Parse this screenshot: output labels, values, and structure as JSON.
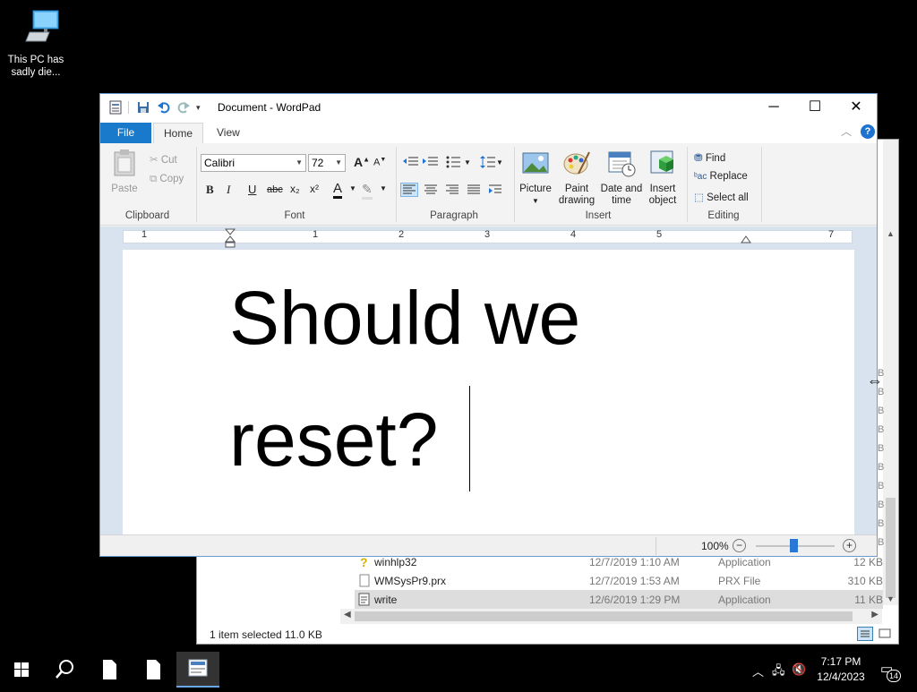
{
  "desktop": {
    "icon_label": "This PC has sadly die..."
  },
  "explorer": {
    "rows": [
      {
        "name": "winhlp32",
        "date": "12/7/2019 1:10 AM",
        "type": "Application",
        "size": "12 KB",
        "selected": false
      },
      {
        "name": "WMSysPr9.prx",
        "date": "12/7/2019 1:53 AM",
        "type": "PRX File",
        "size": "310 KB",
        "selected": false
      },
      {
        "name": "write",
        "date": "12/6/2019 1:29 PM",
        "type": "Application",
        "size": "11 KB",
        "selected": true
      }
    ],
    "status": "1 item selected  11.0 KB",
    "side_letter": "B"
  },
  "wordpad": {
    "title": "Document - WordPad",
    "tabs": {
      "file": "File",
      "home": "Home",
      "view": "View"
    },
    "help": "?",
    "clipboard": {
      "paste": "Paste",
      "cut": "Cut",
      "copy": "Copy",
      "label": "Clipboard"
    },
    "font": {
      "name": "Calibri",
      "size": "72",
      "label": "Font",
      "bold": "B",
      "italic": "I",
      "underline": "U",
      "strike": "abc",
      "sub": "x₂",
      "sup": "x²",
      "color": "A"
    },
    "paragraph": {
      "label": "Paragraph"
    },
    "insert": {
      "picture": "Picture",
      "paint": "Paint drawing",
      "datetime": "Date and time",
      "object": "Insert object",
      "label": "Insert"
    },
    "editing": {
      "find": "Find",
      "replace": "Replace",
      "select_all": "Select all",
      "label": "Editing"
    },
    "ruler_numbers": [
      "1",
      "1",
      "2",
      "3",
      "4",
      "5",
      "7"
    ],
    "document": {
      "line1": "Should we",
      "line2": "reset?"
    },
    "zoom": "100%"
  },
  "taskbar": {
    "time": "7:17 PM",
    "date": "12/4/2023",
    "notifications": "14"
  },
  "colors": {
    "accent": "#1979ca",
    "desktop": "#000000"
  }
}
